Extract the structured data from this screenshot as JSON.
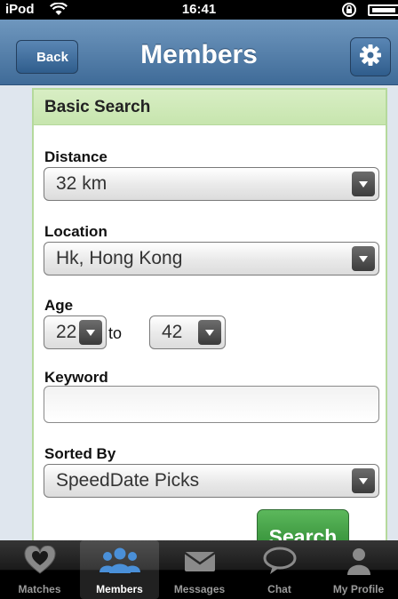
{
  "status_bar": {
    "carrier": "iPod",
    "time": "16:41"
  },
  "nav": {
    "back_label": "Back",
    "title": "Members",
    "settings_icon": "gear-icon"
  },
  "panel": {
    "header": "Basic Search",
    "distance": {
      "label": "Distance",
      "value": "32 km"
    },
    "location": {
      "label": "Location",
      "value": "Hk, Hong Kong"
    },
    "age": {
      "label": "Age",
      "min": "22",
      "separator": "to",
      "max": "42"
    },
    "keyword": {
      "label": "Keyword",
      "value": "",
      "placeholder": ""
    },
    "sorted_by": {
      "label": "Sorted By",
      "value": "SpeedDate Picks"
    },
    "search_label": "Search"
  },
  "tabs": [
    {
      "label": "Matches",
      "icon": "heart-icon",
      "active": false
    },
    {
      "label": "Members",
      "icon": "people-icon",
      "active": true
    },
    {
      "label": "Messages",
      "icon": "envelope-icon",
      "active": false
    },
    {
      "label": "Chat",
      "icon": "chat-bubble-icon",
      "active": false
    },
    {
      "label": "My Profile",
      "icon": "person-icon",
      "active": false
    }
  ],
  "colors": {
    "nav_blue": "#4f7aa6",
    "panel_green": "#c7e5ae",
    "search_green": "#3d9a40",
    "active_tab_icon": "#4a90d9"
  }
}
